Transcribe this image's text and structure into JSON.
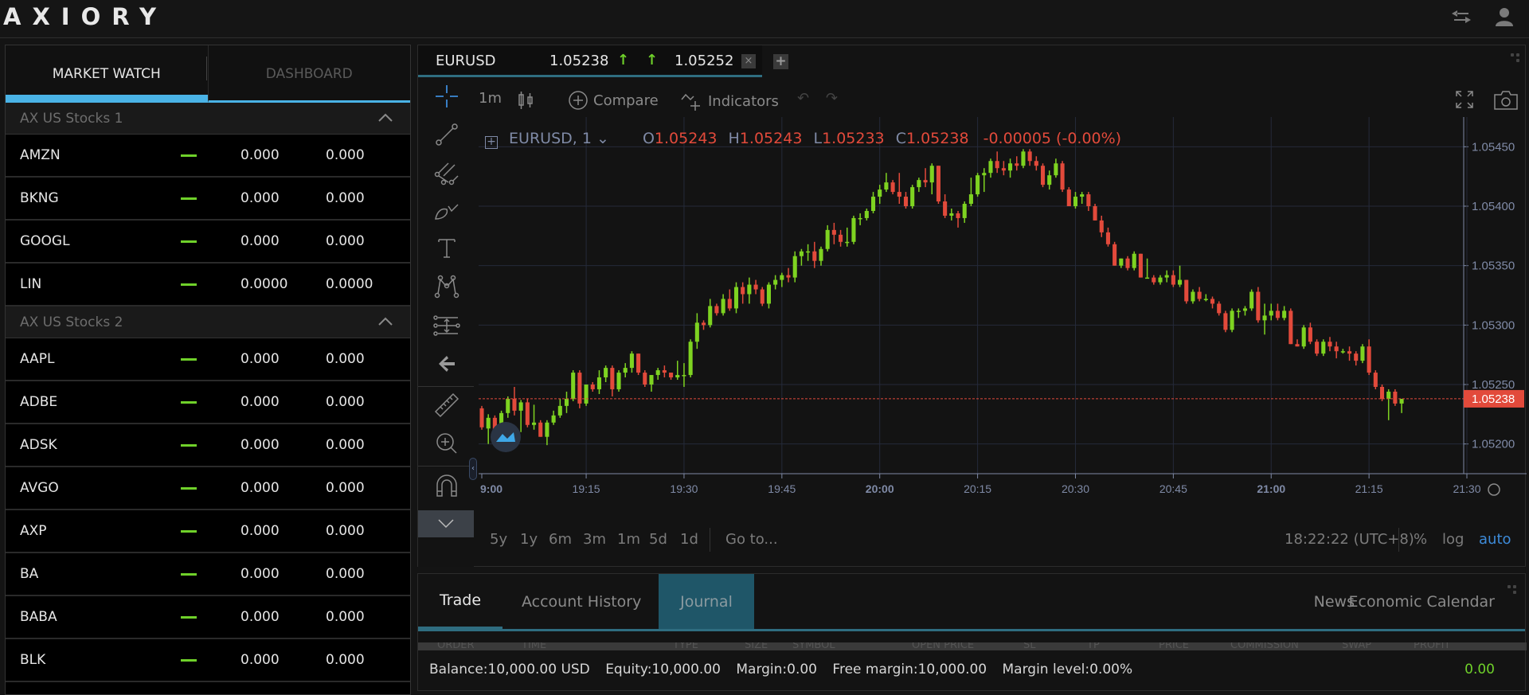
{
  "app": {
    "logo": "AXIORY",
    "icons": [
      "transfer-icon",
      "user-icon"
    ]
  },
  "market_watch": {
    "tabs": [
      {
        "label": "MARKET WATCH",
        "active": true
      },
      {
        "label": "DASHBOARD",
        "active": false
      }
    ],
    "groups": [
      {
        "name": "AX US Stocks 1",
        "expanded": true,
        "rows": [
          {
            "symbol": "AMZN",
            "change": "—",
            "bid": "0.000",
            "ask": "0.000"
          },
          {
            "symbol": "BKNG",
            "change": "—",
            "bid": "0.000",
            "ask": "0.000"
          },
          {
            "symbol": "GOOGL",
            "change": "—",
            "bid": "0.000",
            "ask": "0.000"
          },
          {
            "symbol": "LIN",
            "change": "—",
            "bid": "0.0000",
            "ask": "0.0000"
          }
        ]
      },
      {
        "name": "AX US Stocks 2",
        "expanded": true,
        "rows": [
          {
            "symbol": "AAPL",
            "change": "—",
            "bid": "0.000",
            "ask": "0.000"
          },
          {
            "symbol": "ADBE",
            "change": "—",
            "bid": "0.000",
            "ask": "0.000"
          },
          {
            "symbol": "ADSK",
            "change": "—",
            "bid": "0.000",
            "ask": "0.000"
          },
          {
            "symbol": "AVGO",
            "change": "—",
            "bid": "0.000",
            "ask": "0.000"
          },
          {
            "symbol": "AXP",
            "change": "—",
            "bid": "0.000",
            "ask": "0.000"
          },
          {
            "symbol": "BA",
            "change": "—",
            "bid": "0.000",
            "ask": "0.000"
          },
          {
            "symbol": "BABA",
            "change": "—",
            "bid": "0.000",
            "ask": "0.000"
          },
          {
            "symbol": "BLK",
            "change": "—",
            "bid": "0.000",
            "ask": "0.000"
          }
        ]
      }
    ],
    "colors": {
      "accent": "#4ab3e6",
      "change": "#6fd12a"
    }
  },
  "chart_tab": {
    "symbol": "EURUSD",
    "bid": "1.05238",
    "ask": "1.05252",
    "arrow": "↑",
    "close_label": "×",
    "add_label": "+"
  },
  "toolbar": {
    "interval": "1m",
    "compare": "Compare",
    "indicators": "Indicators",
    "undo": "↶",
    "redo": "↷"
  },
  "legend": {
    "title": "EURUSD, 1",
    "o_label": "O",
    "o": "1.05243",
    "h_label": "H",
    "h": "1.05243",
    "l_label": "L",
    "l": "1.05233",
    "c_label": "C",
    "c": "1.05238",
    "change": "-0.00005 (-0.00%)"
  },
  "range_bar": {
    "ranges": [
      "5y",
      "1y",
      "6m",
      "3m",
      "1m",
      "5d",
      "1d"
    ],
    "goto": "Go to...",
    "clock": "18:22:22 (UTC+8)",
    "percent": "%",
    "log": "log",
    "auto": "auto"
  },
  "chart_data": {
    "type": "candlestick",
    "symbol": "EURUSD",
    "interval": "1m",
    "ylim": [
      1.05175,
      1.05475
    ],
    "y_ticks": [
      "1.05450",
      "1.05400",
      "1.05350",
      "1.05300",
      "1.05250",
      "1.05200"
    ],
    "y_tick_values": [
      1.0545,
      1.054,
      1.0535,
      1.053,
      1.0525,
      1.052
    ],
    "x_ticks": [
      "9:00",
      "19:15",
      "19:30",
      "19:45",
      "20:00",
      "20:15",
      "20:30",
      "20:45",
      "21:00",
      "21:15",
      "21:30"
    ],
    "x_tick_bold": [
      "9:00",
      "20:00",
      "21:00"
    ],
    "x_start_minute": 0,
    "x_end_minute": 151,
    "last_price": 1.05238,
    "last_price_label": "1.05238",
    "colors": {
      "up": "#7ed321",
      "down": "#e24a3b",
      "grid": "#252a3a",
      "axis_text": "#7f8aa6"
    },
    "candles": [
      [
        1.0523,
        1.05232,
        1.05212,
        1.05214
      ],
      [
        1.05213,
        1.05225,
        1.052,
        1.05222
      ],
      [
        1.05222,
        1.05224,
        1.05202,
        1.05206
      ],
      [
        1.05206,
        1.05228,
        1.052,
        1.05226
      ],
      [
        1.05226,
        1.0524,
        1.05222,
        1.05238
      ],
      [
        1.05238,
        1.05248,
        1.05224,
        1.05228
      ],
      [
        1.05228,
        1.05237,
        1.0521,
        1.05235
      ],
      [
        1.05235,
        1.05238,
        1.05214,
        1.05216
      ],
      [
        1.05216,
        1.05233,
        1.05212,
        1.05218
      ],
      [
        1.05218,
        1.0522,
        1.05206,
        1.05206
      ],
      [
        1.05206,
        1.0522,
        1.05199,
        1.05218
      ],
      [
        1.05218,
        1.05228,
        1.05216,
        1.05224
      ],
      [
        1.05224,
        1.05238,
        1.05222,
        1.05232
      ],
      [
        1.05232,
        1.05244,
        1.05226,
        1.05238
      ],
      [
        1.05238,
        1.05262,
        1.05236,
        1.0526
      ],
      [
        1.0526,
        1.05262,
        1.0523,
        1.05234
      ],
      [
        1.05234,
        1.0525,
        1.05232,
        1.0525
      ],
      [
        1.0525,
        1.05252,
        1.05244,
        1.05246
      ],
      [
        1.05246,
        1.05262,
        1.05242,
        1.05256
      ],
      [
        1.05256,
        1.05266,
        1.05252,
        1.05264
      ],
      [
        1.05264,
        1.05266,
        1.0524,
        1.05246
      ],
      [
        1.05246,
        1.05262,
        1.05244,
        1.0526
      ],
      [
        1.0526,
        1.05268,
        1.05256,
        1.05264
      ],
      [
        1.05264,
        1.05278,
        1.0526,
        1.05276
      ],
      [
        1.05276,
        1.05276,
        1.05258,
        1.0526
      ],
      [
        1.0526,
        1.05262,
        1.05248,
        1.0525
      ],
      [
        1.0525,
        1.05258,
        1.05244,
        1.05258
      ],
      [
        1.05258,
        1.05264,
        1.05254,
        1.05262
      ],
      [
        1.05262,
        1.05266,
        1.05256,
        1.0526
      ],
      [
        1.0526,
        1.0526,
        1.05254,
        1.05256
      ],
      [
        1.05256,
        1.0527,
        1.05254,
        1.05258
      ],
      [
        1.05258,
        1.05268,
        1.05248,
        1.05258
      ],
      [
        1.05258,
        1.05288,
        1.05256,
        1.05286
      ],
      [
        1.05286,
        1.0531,
        1.0528,
        1.05302
      ],
      [
        1.05302,
        1.05304,
        1.05296,
        1.053
      ],
      [
        1.053,
        1.05322,
        1.05298,
        1.05316
      ],
      [
        1.05316,
        1.05318,
        1.05308,
        1.0531
      ],
      [
        1.0531,
        1.05326,
        1.05308,
        1.05322
      ],
      [
        1.05322,
        1.0533,
        1.05312,
        1.05314
      ],
      [
        1.05314,
        1.05336,
        1.0531,
        1.05332
      ],
      [
        1.05332,
        1.05336,
        1.05318,
        1.05326
      ],
      [
        1.05326,
        1.0534,
        1.05318,
        1.05334
      ],
      [
        1.05334,
        1.05338,
        1.05326,
        1.0533
      ],
      [
        1.0533,
        1.05332,
        1.05316,
        1.05318
      ],
      [
        1.05318,
        1.05336,
        1.05314,
        1.05334
      ],
      [
        1.05334,
        1.05342,
        1.0533,
        1.05338
      ],
      [
        1.05338,
        1.05344,
        1.05332,
        1.05342
      ],
      [
        1.05342,
        1.05348,
        1.05336,
        1.0534
      ],
      [
        1.0534,
        1.05362,
        1.05336,
        1.05358
      ],
      [
        1.05358,
        1.05364,
        1.0535,
        1.05362
      ],
      [
        1.05362,
        1.05368,
        1.05354,
        1.05362
      ],
      [
        1.05362,
        1.0537,
        1.05348,
        1.05354
      ],
      [
        1.05354,
        1.05366,
        1.0535,
        1.05364
      ],
      [
        1.05364,
        1.05384,
        1.05362,
        1.0538
      ],
      [
        1.0538,
        1.05386,
        1.05368,
        1.05376
      ],
      [
        1.05376,
        1.0538,
        1.05366,
        1.0537
      ],
      [
        1.0537,
        1.05382,
        1.05366,
        1.0537
      ],
      [
        1.0537,
        1.05392,
        1.05368,
        1.0539
      ],
      [
        1.0539,
        1.05394,
        1.05384,
        1.0539
      ],
      [
        1.0539,
        1.05398,
        1.05388,
        1.05396
      ],
      [
        1.05396,
        1.05412,
        1.05394,
        1.05408
      ],
      [
        1.05408,
        1.05418,
        1.05402,
        1.05414
      ],
      [
        1.05414,
        1.05428,
        1.05412,
        1.0542
      ],
      [
        1.0542,
        1.05422,
        1.0541,
        1.05412
      ],
      [
        1.05412,
        1.05428,
        1.05402,
        1.05408
      ],
      [
        1.05408,
        1.05412,
        1.05398,
        1.054
      ],
      [
        1.054,
        1.05418,
        1.05398,
        1.05416
      ],
      [
        1.05416,
        1.05424,
        1.05412,
        1.05422
      ],
      [
        1.05422,
        1.05432,
        1.05416,
        1.0542
      ],
      [
        1.0542,
        1.05436,
        1.0541,
        1.05434
      ],
      [
        1.05434,
        1.05434,
        1.05402,
        1.05404
      ],
      [
        1.05404,
        1.0541,
        1.0539,
        1.05392
      ],
      [
        1.05392,
        1.05398,
        1.05388,
        1.05394
      ],
      [
        1.05394,
        1.05396,
        1.05382,
        1.0539
      ],
      [
        1.0539,
        1.05404,
        1.05386,
        1.05402
      ],
      [
        1.05402,
        1.05424,
        1.054,
        1.0541
      ],
      [
        1.0541,
        1.05428,
        1.05408,
        1.05426
      ],
      [
        1.05426,
        1.05432,
        1.05412,
        1.05428
      ],
      [
        1.05428,
        1.0544,
        1.05424,
        1.05438
      ],
      [
        1.05438,
        1.05446,
        1.05428,
        1.05432
      ],
      [
        1.05432,
        1.05438,
        1.05426,
        1.0543
      ],
      [
        1.0543,
        1.0544,
        1.05424,
        1.05436
      ],
      [
        1.05436,
        1.05442,
        1.0543,
        1.05434
      ],
      [
        1.05434,
        1.05448,
        1.05432,
        1.05446
      ],
      [
        1.05446,
        1.05448,
        1.05434,
        1.05438
      ],
      [
        1.05438,
        1.05442,
        1.0543,
        1.05434
      ],
      [
        1.05434,
        1.05436,
        1.05416,
        1.05418
      ],
      [
        1.05418,
        1.0543,
        1.05414,
        1.05426
      ],
      [
        1.05426,
        1.0544,
        1.05424,
        1.05436
      ],
      [
        1.05436,
        1.05438,
        1.05412,
        1.05414
      ],
      [
        1.05414,
        1.05416,
        1.054,
        1.054
      ],
      [
        1.054,
        1.05412,
        1.05398,
        1.05408
      ],
      [
        1.05408,
        1.05412,
        1.05402,
        1.0541
      ],
      [
        1.0541,
        1.05412,
        1.05396,
        1.054
      ],
      [
        1.054,
        1.05402,
        1.05388,
        1.05388
      ],
      [
        1.05388,
        1.05392,
        1.05374,
        1.05378
      ],
      [
        1.05378,
        1.05382,
        1.05366,
        1.05368
      ],
      [
        1.05368,
        1.0537,
        1.0535,
        1.0535
      ],
      [
        1.0535,
        1.05356,
        1.05348,
        1.05356
      ],
      [
        1.05356,
        1.05358,
        1.05346,
        1.05348
      ],
      [
        1.05348,
        1.05362,
        1.05346,
        1.0536
      ],
      [
        1.0536,
        1.0536,
        1.0534,
        1.0534
      ],
      [
        1.0534,
        1.05356,
        1.0534,
        1.0534
      ],
      [
        1.0534,
        1.05342,
        1.05334,
        1.05336
      ],
      [
        1.05336,
        1.05342,
        1.05334,
        1.0534
      ],
      [
        1.0534,
        1.05346,
        1.05336,
        1.05342
      ],
      [
        1.05342,
        1.05346,
        1.05332,
        1.05334
      ],
      [
        1.05334,
        1.0535,
        1.05332,
        1.05338
      ],
      [
        1.05338,
        1.05338,
        1.05318,
        1.0532
      ],
      [
        1.0532,
        1.0533,
        1.05318,
        1.05328
      ],
      [
        1.05328,
        1.05332,
        1.0532,
        1.05322
      ],
      [
        1.05322,
        1.05326,
        1.0532,
        1.05322
      ],
      [
        1.05322,
        1.05324,
        1.05314,
        1.05318
      ],
      [
        1.05318,
        1.0532,
        1.05308,
        1.0531
      ],
      [
        1.0531,
        1.05312,
        1.05294,
        1.05296
      ],
      [
        1.05296,
        1.05314,
        1.05294,
        1.05312
      ],
      [
        1.05312,
        1.05314,
        1.05306,
        1.05312
      ],
      [
        1.05312,
        1.05316,
        1.05308,
        1.05314
      ],
      [
        1.05314,
        1.0533,
        1.05312,
        1.05328
      ],
      [
        1.05328,
        1.05332,
        1.05302,
        1.05304
      ],
      [
        1.05304,
        1.05318,
        1.05292,
        1.05308
      ],
      [
        1.05308,
        1.05318,
        1.05304,
        1.05312
      ],
      [
        1.05312,
        1.05318,
        1.05304,
        1.05306
      ],
      [
        1.05306,
        1.05316,
        1.05304,
        1.05312
      ],
      [
        1.05312,
        1.05314,
        1.05284,
        1.05284
      ],
      [
        1.05284,
        1.05288,
        1.05282,
        1.05282
      ],
      [
        1.05282,
        1.053,
        1.0528,
        1.05298
      ],
      [
        1.05298,
        1.05302,
        1.05284,
        1.05286
      ],
      [
        1.05286,
        1.05288,
        1.05274,
        1.05276
      ],
      [
        1.05276,
        1.05288,
        1.05274,
        1.05286
      ],
      [
        1.05286,
        1.0529,
        1.05278,
        1.05282
      ],
      [
        1.05282,
        1.05286,
        1.05272,
        1.05278
      ],
      [
        1.05278,
        1.0528,
        1.05276,
        1.05278
      ],
      [
        1.05278,
        1.05282,
        1.0527,
        1.05276
      ],
      [
        1.05276,
        1.05278,
        1.05266,
        1.0527
      ],
      [
        1.0527,
        1.05284,
        1.05268,
        1.05282
      ],
      [
        1.05282,
        1.05288,
        1.05258,
        1.0526
      ],
      [
        1.0526,
        1.05262,
        1.05246,
        1.05248
      ],
      [
        1.05248,
        1.0525,
        1.05236,
        1.05238
      ],
      [
        1.05238,
        1.05246,
        1.0522,
        1.05244
      ],
      [
        1.05244,
        1.05246,
        1.05232,
        1.05234
      ],
      [
        1.05234,
        1.05236,
        1.05226,
        1.05238
      ]
    ]
  },
  "bottom_panel": {
    "tabs": [
      {
        "label": "Trade",
        "active": true
      },
      {
        "label": "Account History",
        "active": false
      },
      {
        "label": "Journal",
        "active": false,
        "highlighted": true
      }
    ],
    "right_links": [
      "News",
      "Economic Calendar"
    ],
    "columns": [
      "ORDER",
      "TIME",
      "TYPE",
      "SIZE",
      "SYMBOL",
      "OPEN PRICE",
      "SL",
      "TP",
      "PRICE",
      "COMMISSION",
      "SWAP",
      "PROFIT"
    ],
    "status": {
      "balance": "Balance:10,000.00 USD",
      "equity": "Equity:10,000.00",
      "margin": "Margin:0.00",
      "free_margin": "Free margin:10,000.00",
      "margin_level": "Margin level:0.00%"
    },
    "profit": "0.00"
  }
}
